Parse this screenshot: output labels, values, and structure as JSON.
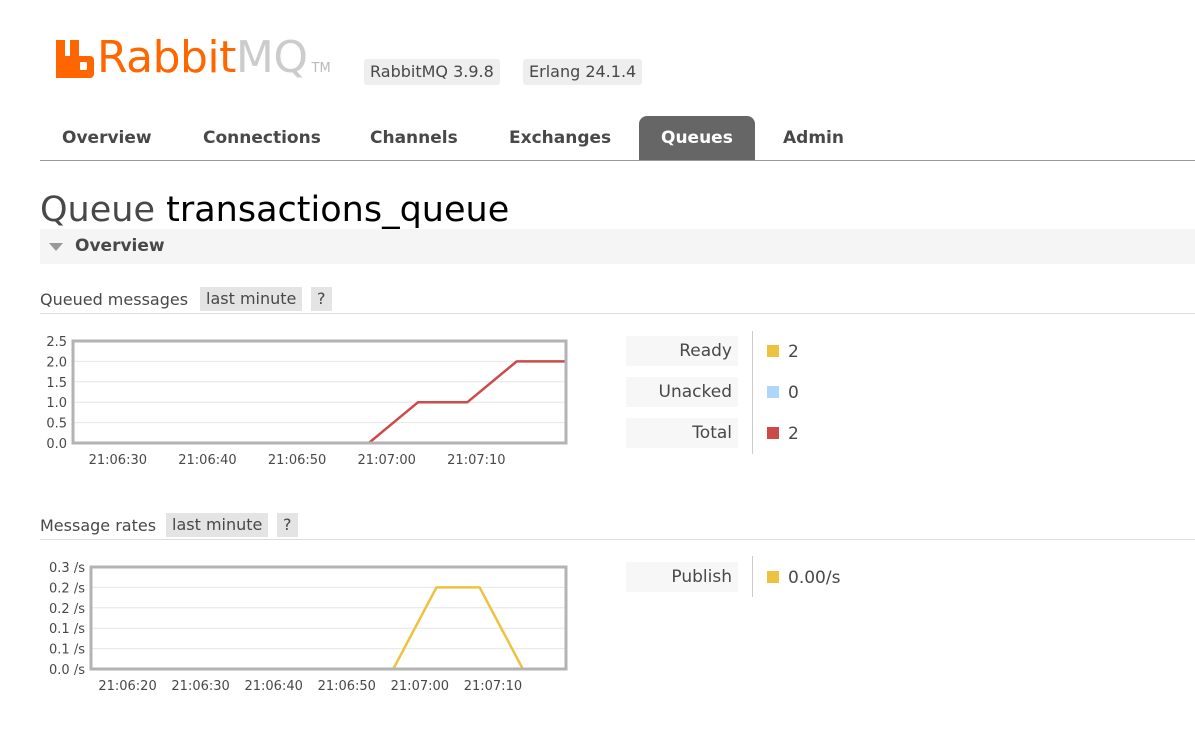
{
  "header": {
    "logo": {
      "brand": "Rabbit",
      "brand_suffix": "MQ",
      "tm": "TM"
    },
    "rabbitmq_version": "RabbitMQ 3.9.8",
    "erlang_version": "Erlang 24.1.4"
  },
  "tabs": [
    {
      "label": "Overview",
      "selected": false
    },
    {
      "label": "Connections",
      "selected": false
    },
    {
      "label": "Channels",
      "selected": false
    },
    {
      "label": "Exchanges",
      "selected": false
    },
    {
      "label": "Queues",
      "selected": true
    },
    {
      "label": "Admin",
      "selected": false
    }
  ],
  "page": {
    "title_prefix": "Queue",
    "queue_name": "transactions_queue",
    "section_label": "Overview"
  },
  "queued_messages": {
    "title": "Queued messages",
    "range_label": "last minute",
    "help_label": "?",
    "legend": [
      {
        "label": "Ready",
        "value": "2",
        "color": "#edc240"
      },
      {
        "label": "Unacked",
        "value": "0",
        "color": "#afd8f8"
      },
      {
        "label": "Total",
        "value": "2",
        "color": "#cb4b4b"
      }
    ]
  },
  "message_rates": {
    "title": "Message rates",
    "range_label": "last minute",
    "help_label": "?",
    "legend": [
      {
        "label": "Publish",
        "value": "0.00/s",
        "color": "#edc240"
      }
    ]
  },
  "chart_data": [
    {
      "type": "line",
      "title": "Queued messages",
      "ylim": [
        0,
        2.5
      ],
      "y_ticks": [
        "2.5",
        "2.0",
        "1.5",
        "1.0",
        "0.5",
        "0.0"
      ],
      "x_ticks": [
        "21:06:30",
        "21:06:40",
        "21:06:50",
        "21:07:00",
        "21:07:10"
      ],
      "xlim": [
        20,
        70
      ],
      "grid": true,
      "series": [
        {
          "name": "Unacked",
          "color": "#afd8f8",
          "x": [
            20,
            50,
            70
          ],
          "values": [
            0,
            0,
            0
          ]
        },
        {
          "name": "Total",
          "color": "#cb4b4b",
          "x": [
            20,
            50,
            55,
            60,
            65,
            70
          ],
          "values": [
            0,
            0,
            1,
            1,
            2,
            2
          ]
        }
      ]
    },
    {
      "type": "line",
      "title": "Message rates",
      "ylim": [
        0,
        0.25
      ],
      "y_ticks": [
        "0.3 /s",
        "0.2 /s",
        "0.2 /s",
        "0.1 /s",
        "0.1 /s",
        "0.0 /s"
      ],
      "x_ticks": [
        "21:06:20",
        "21:06:30",
        "21:06:40",
        "21:06:50",
        "21:07:00",
        "21:07:10"
      ],
      "xlim": [
        15,
        70
      ],
      "grid": true,
      "series": [
        {
          "name": "Publish",
          "color": "#edc240",
          "x": [
            15,
            50,
            55,
            60,
            65,
            70
          ],
          "values": [
            0,
            0,
            0.2,
            0.2,
            0,
            0
          ]
        }
      ]
    }
  ]
}
